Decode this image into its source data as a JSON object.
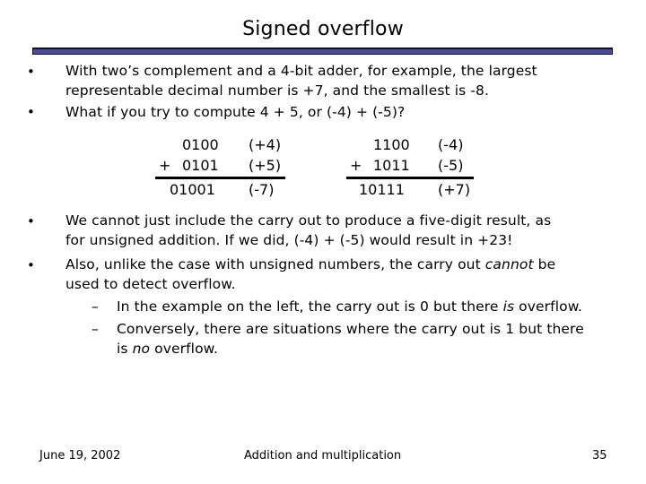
{
  "slide": {
    "title": "Signed overflow",
    "accent_color": "#4b4b96",
    "bullets_top": [
      {
        "lines": [
          "With two’s complement and a 4-bit adder, for example, the largest",
          "representable decimal number is +7, and the smallest is -8."
        ]
      },
      {
        "lines": [
          "What if you try to compute 4 + 5, or (-4) + (-5)?"
        ]
      }
    ],
    "examples": [
      {
        "operand1": "0100",
        "operand1_label": "(+4)",
        "operator": "+",
        "operand2": "0101",
        "operand2_label": "(+5)",
        "result": "01001",
        "result_label": "(-7)"
      },
      {
        "operand1": "1100",
        "operand1_label": "(-4)",
        "operator": "+",
        "operand2": "1011",
        "operand2_label": "(-5)",
        "result": "10111",
        "result_label": "(+7)"
      }
    ],
    "bullets_bottom": [
      {
        "lines": [
          "We cannot just include the carry out to produce a five-digit result, as",
          "for unsigned addition. If we did, (-4) + (-5) would result in +23!"
        ]
      },
      {
        "line1_before": "Also, unlike the case with unsigned numbers, the carry out ",
        "line1_em": "cannot",
        "line1_after": " be",
        "line2": "used to detect overflow."
      }
    ],
    "sub_bullets": [
      {
        "before": "In the example on the left, the carry out is 0 but there ",
        "em": "is",
        "after": " overflow."
      },
      {
        "line1": "Conversely, there are situations where the carry out is 1 but there",
        "line2_before": "is ",
        "line2_em": "no",
        "line2_after": " overflow."
      }
    ],
    "bullet_glyph": "•",
    "dash_glyph": "–"
  },
  "footer": {
    "date": "June 19, 2002",
    "topic": "Addition and multiplication",
    "page_number": "35"
  }
}
